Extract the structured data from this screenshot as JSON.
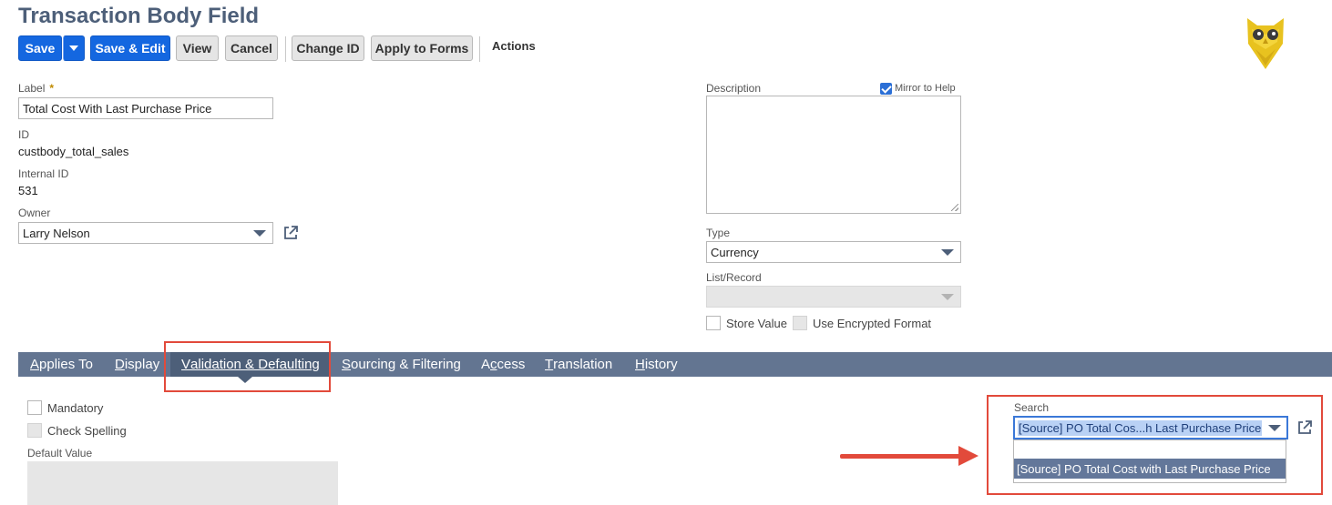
{
  "page": {
    "title": "Transaction Body Field"
  },
  "toolbar": {
    "save": "Save",
    "save_edit": "Save & Edit",
    "view": "View",
    "cancel": "Cancel",
    "change_id": "Change ID",
    "apply_to_forms": "Apply to Forms",
    "actions": "Actions"
  },
  "form": {
    "label": {
      "label": "Label",
      "required": "*",
      "value": "Total Cost With Last Purchase Price"
    },
    "id": {
      "label": "ID",
      "value": "custbody_total_sales"
    },
    "internal_id": {
      "label": "Internal ID",
      "value": "531"
    },
    "owner": {
      "label": "Owner",
      "value": "Larry Nelson"
    },
    "description": {
      "label": "Description",
      "value": ""
    },
    "mirror_to_help": {
      "label": "Mirror to Help",
      "checked": true
    },
    "type": {
      "label": "Type",
      "value": "Currency"
    },
    "list_record": {
      "label": "List/Record",
      "value": ""
    },
    "store_value": {
      "label": "Store Value",
      "checked": false
    },
    "use_encrypted_format": {
      "label": "Use Encrypted Format",
      "checked": false
    }
  },
  "tabs": [
    {
      "first": "A",
      "rest": "pplies To"
    },
    {
      "first": "D",
      "rest": "isplay"
    },
    {
      "first": "V",
      "rest": "alidation & Defaulting",
      "active": true
    },
    {
      "first": "S",
      "rest": "ourcing & Filtering"
    },
    {
      "pre": "A",
      "first": "c",
      "rest": "cess"
    },
    {
      "first": "T",
      "rest": "ranslation"
    },
    {
      "first": "H",
      "rest": "istory"
    }
  ],
  "validation": {
    "mandatory": {
      "label": "Mandatory",
      "checked": false
    },
    "check_spelling": {
      "label": "Check Spelling",
      "checked": false
    },
    "default_value": {
      "label": "Default Value"
    },
    "search": {
      "label": "Search",
      "value": "[Source] PO Total Cos...h Last Purchase Price",
      "options": [
        "",
        "[Source] PO Total Cost with Last Purchase Price"
      ]
    }
  },
  "colors": {
    "title": "#4d5f79",
    "primary_button": "#1467e0",
    "tab_bar": "#637591",
    "tab_active": "#4d5f79",
    "annotation_red": "#e24a3b"
  }
}
